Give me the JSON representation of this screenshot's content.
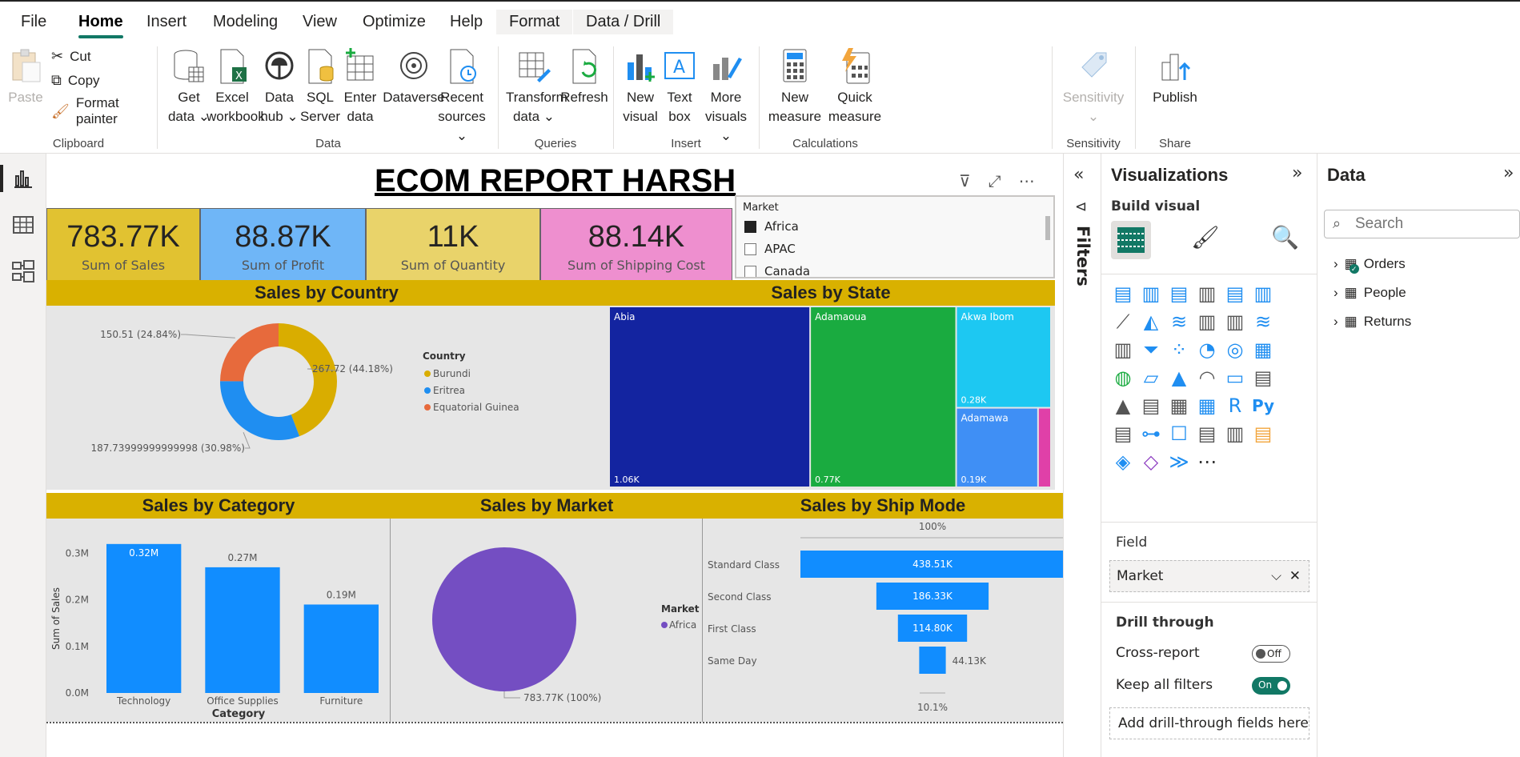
{
  "menu": {
    "tabs": [
      "File",
      "Home",
      "Insert",
      "Modeling",
      "View",
      "Optimize",
      "Help",
      "Format",
      "Data / Drill"
    ]
  },
  "ribbon": {
    "clipboard": {
      "paste": "Paste",
      "cut": "Cut",
      "copy": "Copy",
      "format_painter": "Format painter",
      "label": "Clipboard"
    },
    "data": {
      "get_data": "Get",
      "get_data2": "data",
      "excel": "Excel",
      "excel2": "workbook",
      "hub": "Data",
      "hub2": "hub",
      "sql": "SQL",
      "sql2": "Server",
      "enter": "Enter",
      "enter2": "data",
      "dataverse": "Dataverse",
      "recent": "Recent",
      "recent2": "sources",
      "label": "Data"
    },
    "queries": {
      "transform": "Transform",
      "transform2": "data",
      "refresh": "Refresh",
      "label": "Queries"
    },
    "insert": {
      "new_visual": "New",
      "new_visual2": "visual",
      "text_box": "Text",
      "text_box2": "box",
      "more": "More",
      "more2": "visuals",
      "label": "Insert"
    },
    "calculations": {
      "new_measure": "New",
      "new_measure2": "measure",
      "quick": "Quick",
      "quick2": "measure",
      "label": "Calculations"
    },
    "sensitivity": {
      "btn": "Sensitivity",
      "label": "Sensitivity"
    },
    "share": {
      "publish": "Publish",
      "label": "Share"
    }
  },
  "report": {
    "title": "ECOM REPORT HARSH"
  },
  "kpis": [
    {
      "value": "783.77K",
      "label": "Sum of Sales",
      "color": "#e1c231"
    },
    {
      "value": "88.87K",
      "label": "Sum of Profit",
      "color": "#6fb6f7"
    },
    {
      "value": "11K",
      "label": "Sum of Quantity",
      "color": "#e9d36a"
    },
    {
      "value": "88.14K",
      "label": "Sum of Shipping Cost",
      "color": "#ee8fcf"
    }
  ],
  "slicer": {
    "title": "Market",
    "items": [
      {
        "label": "Africa",
        "checked": true
      },
      {
        "label": "APAC",
        "checked": false
      },
      {
        "label": "Canada",
        "checked": false
      }
    ]
  },
  "visuals": {
    "country": "Sales by Country",
    "state": "Sales by State",
    "category": "Sales by Category",
    "market": "Sales by Market",
    "shipmode": "Sales by Ship Mode"
  },
  "chart_data": [
    {
      "type": "pie",
      "title": "Sales by Country",
      "legend_title": "Country",
      "categories": [
        "Burundi",
        "Eritrea",
        "Equatorial Guinea"
      ],
      "values": [
        267.72,
        187.73999999999998,
        150.51
      ],
      "labels": [
        "267.72 (44.18%)",
        "187.73999999999998 (30.98%)",
        "150.51 (24.84%)"
      ],
      "colors": [
        "#d9ad00",
        "#1f8ef1",
        "#e76a3c"
      ]
    },
    {
      "type": "treemap",
      "title": "Sales by State",
      "items": [
        {
          "name": "Abia",
          "value": 1060,
          "label": "1.06K",
          "color": "#1324a0"
        },
        {
          "name": "Adamaoua",
          "value": 770,
          "label": "0.77K",
          "color": "#1aab40"
        },
        {
          "name": "Akwa Ibom",
          "value": 280,
          "label": "0.28K",
          "color": "#1dc8f2"
        },
        {
          "name": "Adamawa",
          "value": 190,
          "label": "0.19K",
          "color": "#3f8ff5"
        },
        {
          "name": "",
          "value": 30,
          "label": "",
          "color": "#e040a8"
        }
      ]
    },
    {
      "type": "bar",
      "title": "Sales by Category",
      "categories": [
        "Technology",
        "Office Supplies",
        "Furniture"
      ],
      "values": [
        0.32,
        0.27,
        0.19
      ],
      "labels": [
        "0.32M",
        "0.27M",
        "0.19M"
      ],
      "xlabel": "Category",
      "ylabel": "Sum of Sales",
      "yticks": [
        "0.0M",
        "0.1M",
        "0.2M",
        "0.3M"
      ],
      "ylim": [
        0,
        0.33
      ],
      "color": "#118dff"
    },
    {
      "type": "pie",
      "title": "Sales by Market",
      "legend_title": "Market",
      "categories": [
        "Africa"
      ],
      "values": [
        783.77
      ],
      "labels": [
        "783.77K (100%)"
      ],
      "colors": [
        "#744ec2"
      ]
    },
    {
      "type": "funnel",
      "title": "Sales by Ship Mode",
      "categories": [
        "Standard Class",
        "Second Class",
        "First Class",
        "Same Day"
      ],
      "values": [
        438.51,
        186.33,
        114.8,
        44.13
      ],
      "labels": [
        "438.51K",
        "186.33K",
        "114.80K",
        "44.13K"
      ],
      "top_pct": "100%",
      "bottom_pct": "10.1%",
      "color": "#118dff"
    }
  ],
  "filters": {
    "label": "Filters"
  },
  "viz": {
    "title": "Visualizations",
    "build": "Build visual",
    "field_label": "Field",
    "field_value": "Market",
    "drill": "Drill through",
    "cross": "Cross-report",
    "cross_state": "Off",
    "keep": "Keep all filters",
    "keep_state": "On",
    "add_drill": "Add drill-through fields here"
  },
  "data_pane": {
    "title": "Data",
    "search_placeholder": "Search",
    "tables": [
      "Orders",
      "People",
      "Returns"
    ]
  }
}
